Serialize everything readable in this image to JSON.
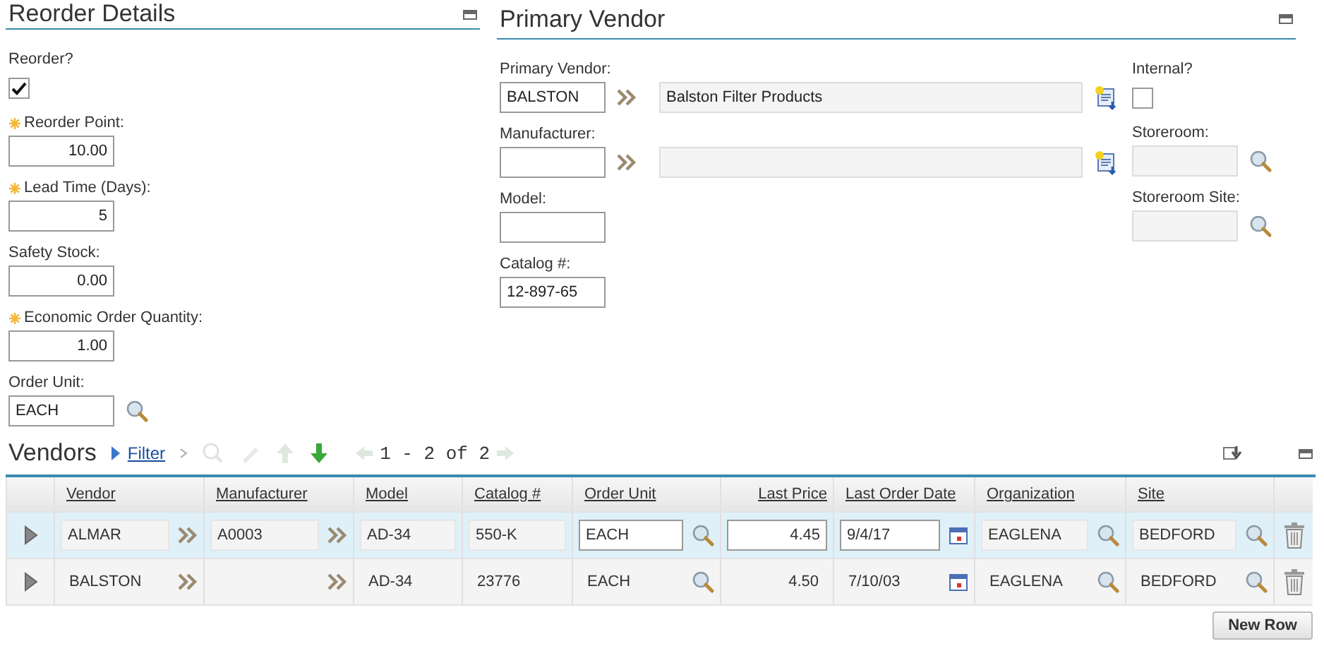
{
  "reorder": {
    "title": "Reorder Details",
    "fields": [
      {
        "kind": "checkbox",
        "label": "Reorder?",
        "checked": true
      },
      {
        "kind": "number",
        "label": "Reorder Point:",
        "required": true,
        "value": "10.00"
      },
      {
        "kind": "number",
        "label": "Lead Time (Days):",
        "required": true,
        "value": "5"
      },
      {
        "kind": "number",
        "label": "Safety Stock:",
        "required": false,
        "value": "0.00"
      },
      {
        "kind": "number",
        "label": "Economic Order Quantity:",
        "required": true,
        "value": "1.00"
      },
      {
        "kind": "lookup",
        "label": "Order Unit:",
        "value": "EACH"
      }
    ]
  },
  "primary_vendor": {
    "title": "Primary Vendor",
    "fields": [
      {
        "kind": "linked",
        "label": "Primary Vendor:",
        "value": "BALSTON",
        "description": "Balston Filter Products"
      },
      {
        "kind": "linked",
        "label": "Manufacturer:"
      },
      {
        "kind": "text",
        "label": "Model:"
      },
      {
        "kind": "text",
        "label": "Catalog #:",
        "value": "12-897-65"
      }
    ],
    "side_fields": [
      {
        "kind": "checkbox",
        "label": "Internal?",
        "checked": false
      },
      {
        "kind": "lookup",
        "label": "Storeroom:"
      },
      {
        "kind": "lookup",
        "label": "Storeroom Site:"
      }
    ]
  },
  "vendors": {
    "title": "Vendors",
    "filter": "Filter",
    "pagination": "1 - 2 of 2",
    "columns": [
      {
        "name": "Vendor",
        "editable": false,
        "numeric": false,
        "kind": "link"
      },
      {
        "name": "Manufacturer",
        "editable": false,
        "numeric": false,
        "kind": "link"
      },
      {
        "name": "Model",
        "editable": false,
        "numeric": false,
        "kind": "plain"
      },
      {
        "name": "Catalog #",
        "editable": false,
        "numeric": false,
        "kind": "plain"
      },
      {
        "name": "Order Unit",
        "editable": true,
        "numeric": false,
        "kind": "lookup"
      },
      {
        "name": "Last Price",
        "editable": true,
        "numeric": true,
        "kind": "plain"
      },
      {
        "name": "Last Order Date",
        "editable": true,
        "numeric": false,
        "kind": "calendar"
      },
      {
        "name": "Organization",
        "editable": false,
        "numeric": false,
        "kind": "lookup"
      },
      {
        "name": "Site",
        "editable": false,
        "numeric": false,
        "kind": "lookup"
      }
    ],
    "rows": [
      {
        "selected": true,
        "cells": [
          "ALMAR",
          "A0003",
          "AD-34",
          "550-K",
          "EACH",
          "4.45",
          "9/4/17",
          "EAGLENA",
          "BEDFORD"
        ]
      },
      {
        "selected": false,
        "cells": [
          "BALSTON",
          null,
          "AD-34",
          "23776",
          "EACH",
          "4.50",
          "7/10/03",
          "EAGLENA",
          "BEDFORD"
        ]
      }
    ],
    "new_row_button": "New Row"
  }
}
